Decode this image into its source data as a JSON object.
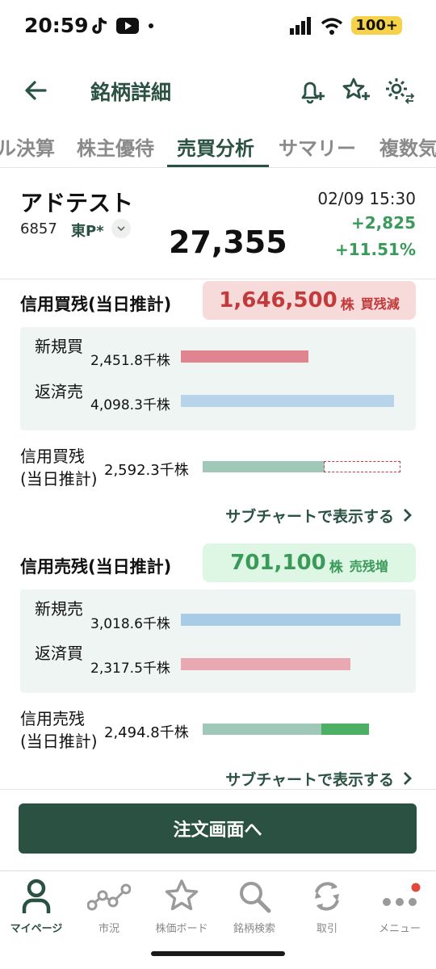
{
  "status_bar": {
    "time": "20:59",
    "battery": "100+"
  },
  "header": {
    "title": "銘柄詳細"
  },
  "tabs": [
    {
      "label": "ル決算"
    },
    {
      "label": "株主優待"
    },
    {
      "label": "売買分析",
      "active": true
    },
    {
      "label": "サマリー"
    },
    {
      "label": "複数気"
    }
  ],
  "stock": {
    "name": "アドテスト",
    "code": "6857",
    "market": "東P*",
    "price": "27,355",
    "time": "02/09 15:30",
    "change": "+2,825",
    "change_pct": "+11.51%"
  },
  "margin_buy": {
    "title": "信用買残(当日推計)",
    "badge_value": "1,646,500",
    "badge_unit": "株",
    "badge_status": "買残減",
    "new_label": "新規買",
    "new_value": "2,451.8千株",
    "new_fraction": 0.6,
    "repay_label": "返済売",
    "repay_value": "4,098.3千株",
    "repay_fraction": 1.0,
    "balance_label_1": "信用買残",
    "balance_label_2": "(当日推計)",
    "balance_value": "2,592.3千株",
    "balance_fraction": 0.61,
    "prev_fraction": 1.0
  },
  "margin_sell": {
    "title": "信用売残(当日推計)",
    "badge_value": "701,100",
    "badge_unit": "株",
    "badge_status": "売残増",
    "new_label": "新規売",
    "new_value": "3,018.6千株",
    "new_fraction": 1.0,
    "repay_label": "返済買",
    "repay_value": "2,317.5千株",
    "repay_fraction": 0.77,
    "balance_label_1": "信用売残",
    "balance_label_2": "(当日推計)",
    "balance_value": "2,494.8千株",
    "base_fraction": 0.6,
    "increase_fraction": 0.24
  },
  "sub_chart_link": "サブチャートで表示する",
  "order_button": "注文画面へ",
  "bottom_nav": [
    {
      "label": "マイページ",
      "icon": "person-icon",
      "active": true
    },
    {
      "label": "市況",
      "icon": "market-icon"
    },
    {
      "label": "株価ボード",
      "icon": "star-icon"
    },
    {
      "label": "銘柄検索",
      "icon": "search-icon"
    },
    {
      "label": "取引",
      "icon": "recycle-icon"
    },
    {
      "label": "メニュー",
      "icon": "menu-dots-icon"
    }
  ],
  "colors": {
    "brand": "#2a5141",
    "up": "#3a9a5a",
    "new_buy": "#e08490",
    "repay_sell": "#b7d4ea",
    "balance": "#9fc8b8",
    "new_sell": "#a8cbe6",
    "repay_buy": "#e8a9b2",
    "increase": "#4caf64"
  }
}
